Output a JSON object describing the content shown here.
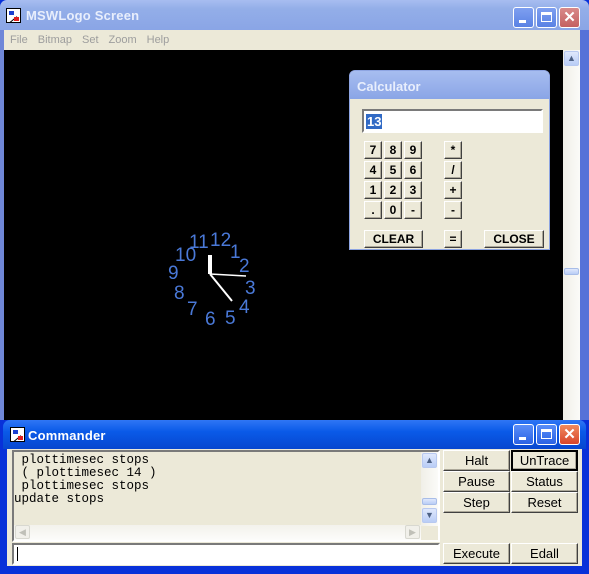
{
  "main_window": {
    "title": "MSWLogo Screen",
    "menu": [
      "File",
      "Bitmap",
      "Set",
      "Zoom",
      "Help"
    ],
    "canvas_background": "#000000"
  },
  "clock": {
    "numerals": [
      "1",
      "2",
      "3",
      "4",
      "5",
      "6",
      "7",
      "8",
      "9",
      "10",
      "11",
      "12"
    ],
    "numeral_color": "#4a79d8",
    "hands_color": "#ffffff"
  },
  "calculator": {
    "title": "Calculator",
    "display_value": "13",
    "keys": {
      "row1": [
        "7",
        "8",
        "9"
      ],
      "row2": [
        "4",
        "5",
        "6"
      ],
      "row3": [
        "1",
        "2",
        "3"
      ],
      "row4": [
        ".",
        "0",
        "-"
      ],
      "ops": [
        "*",
        "/",
        "+",
        "-"
      ]
    },
    "clear_label": "CLEAR",
    "equals_label": "=",
    "close_label": "CLOSE"
  },
  "commander": {
    "title": "Commander",
    "output_lines": [
      " plottimesec stops",
      " ( plottimesec 14 )",
      " plottimesec stops",
      "update stops"
    ],
    "input_value": "",
    "buttons": {
      "halt": "Halt",
      "untrace": "UnTrace",
      "pause": "Pause",
      "status": "Status",
      "step": "Step",
      "reset": "Reset",
      "execute": "Execute",
      "edall": "Edall"
    }
  },
  "window_controls": {
    "minimize": "minimize",
    "maximize": "maximize",
    "close": "✕"
  }
}
